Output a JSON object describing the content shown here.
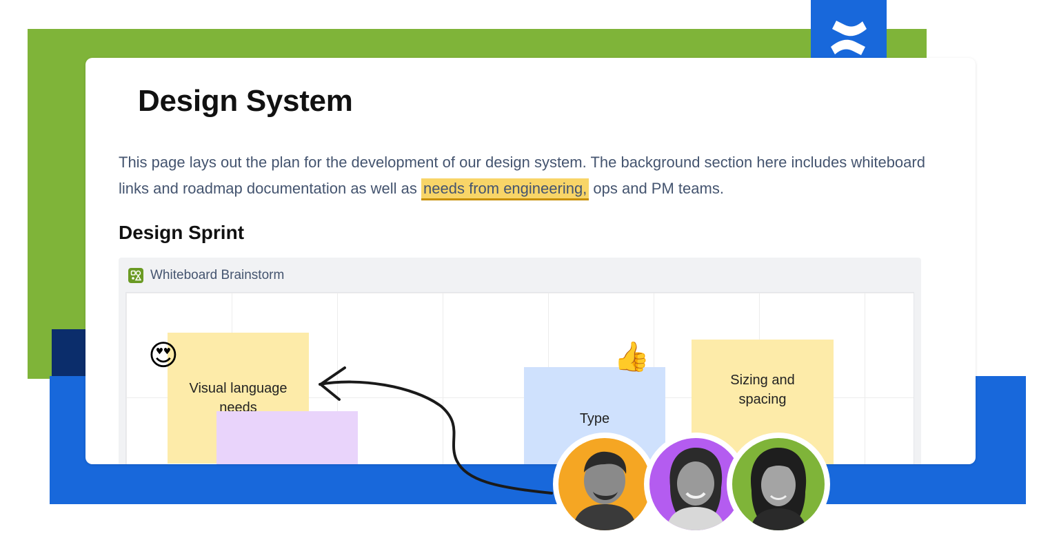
{
  "brand": {
    "accent": "#1868db",
    "green": "#7fb439",
    "navy": "#0b2d6b",
    "logo_icon": "confluence-logo-icon"
  },
  "page": {
    "title": "Design System",
    "intro_before": "This page lays out the plan for the development of our design system. The background section here includes whiteboard links and roadmap documentation as well as ",
    "intro_highlight": "needs from engineering,",
    "intro_after": " ops and PM teams.",
    "highlight_color": "#f8d568",
    "section_heading": "Design Sprint"
  },
  "whiteboard": {
    "icon": "whiteboard-icon",
    "title": "Whiteboard Brainstorm",
    "notes": [
      {
        "id": "visual",
        "label": "Visual language needs",
        "color": "yellow"
      },
      {
        "id": "purple",
        "label": "",
        "color": "purple"
      },
      {
        "id": "type",
        "label": "Type",
        "color": "blue"
      },
      {
        "id": "sizing",
        "label": "Sizing and spacing",
        "color": "yellow"
      }
    ],
    "reactions": [
      {
        "emoji": "😍",
        "name": "heart-eyes-emoji"
      },
      {
        "emoji": "👍",
        "name": "thumbs-up-emoji"
      }
    ]
  },
  "collaborators": [
    {
      "name": "avatar-1",
      "ring_color": "#f5a623"
    },
    {
      "name": "avatar-2",
      "ring_color": "#b45cf0"
    },
    {
      "name": "avatar-3",
      "ring_color": "#7fb439"
    }
  ]
}
